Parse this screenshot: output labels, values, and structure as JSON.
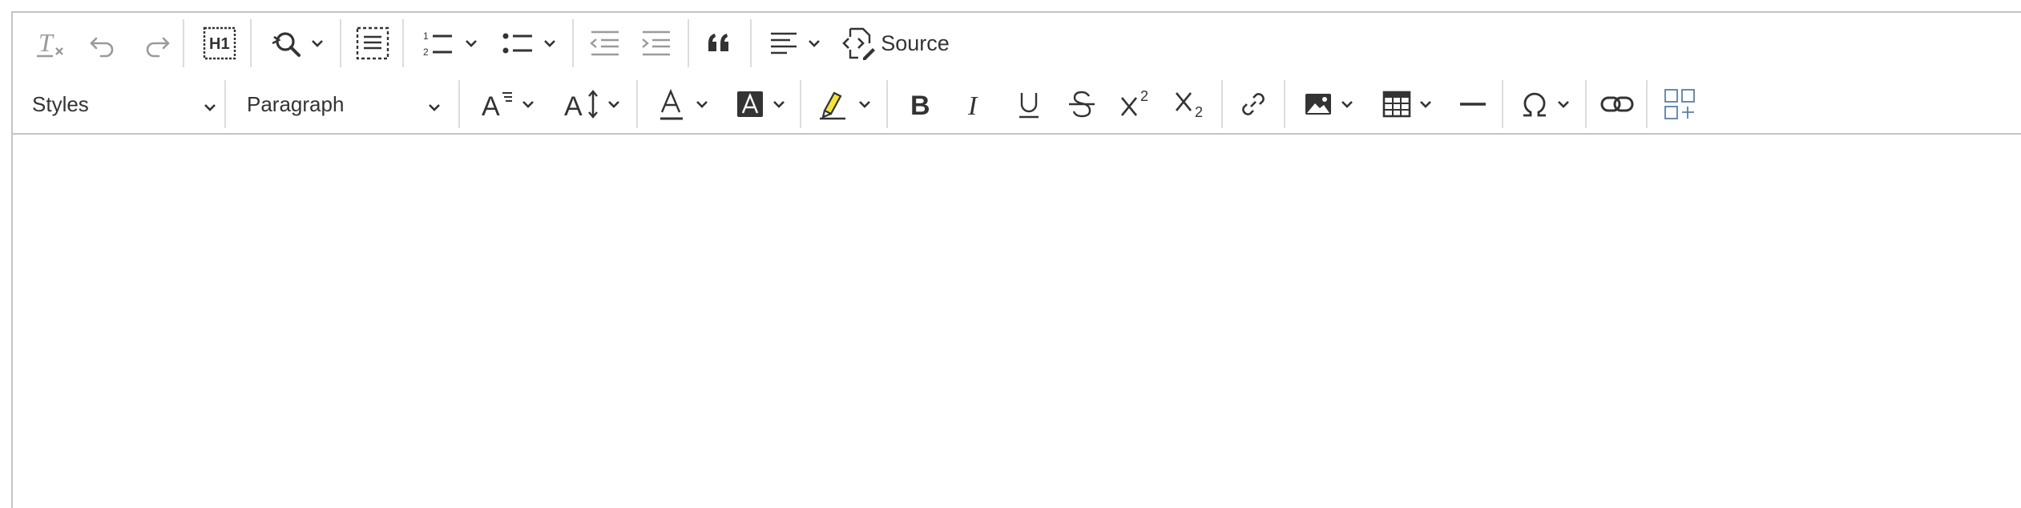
{
  "toolbar": {
    "row1": {
      "source_label": "Source"
    },
    "row2": {
      "styles_value": "Styles",
      "format_value": "Paragraph",
      "superscript_digit": "2",
      "subscript_digit": "2"
    }
  },
  "colors": {
    "border": "#c4c4c4",
    "separator": "#dcdcdc",
    "icon": "#333333",
    "icon_disabled": "#9a9a9a",
    "highlight": "#f5e33d",
    "accent_blue": "#5a7fa6"
  },
  "icons": [
    "remove-format-icon",
    "undo-icon",
    "redo-icon",
    "heading-icon",
    "find-replace-icon",
    "select-all-icon",
    "numbered-list-icon",
    "bulleted-list-icon",
    "outdent-icon",
    "indent-icon",
    "blockquote-icon",
    "align-icon",
    "source-icon",
    "font-size-icon",
    "line-height-icon",
    "font-color-icon",
    "background-color-icon",
    "highlight-icon",
    "bold-icon",
    "italic-icon",
    "underline-icon",
    "strikethrough-icon",
    "superscript-icon",
    "subscript-icon",
    "link-icon",
    "image-icon",
    "table-icon",
    "horizontal-line-icon",
    "special-characters-icon",
    "unlink-icon",
    "show-blocks-icon"
  ]
}
